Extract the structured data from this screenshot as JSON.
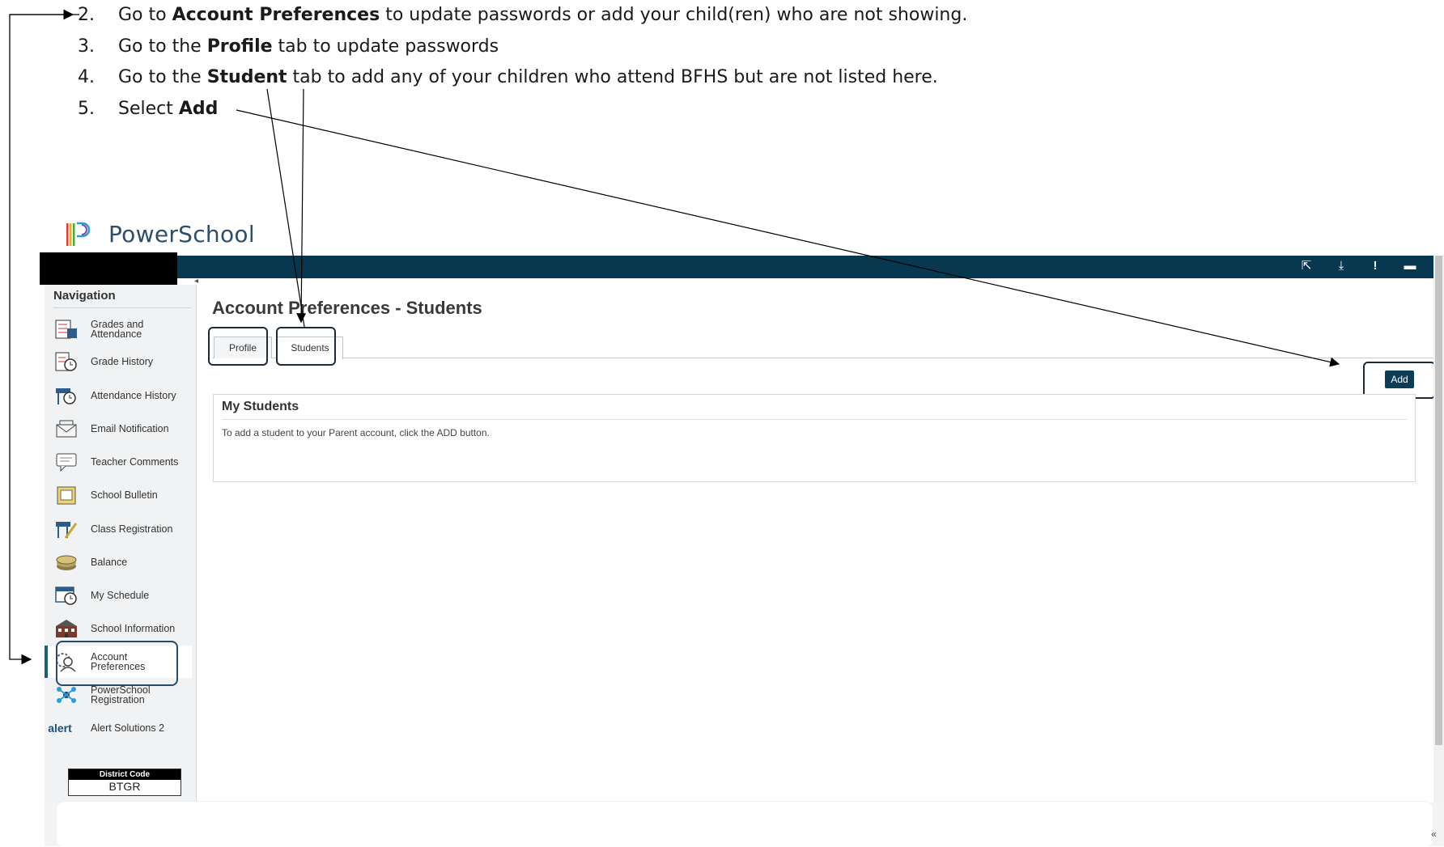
{
  "instructions": {
    "steps": [
      {
        "num": "2.",
        "pre": "Go to ",
        "bold": "Account Preferences",
        "post": " to update passwords or add your child(ren) who are not showing."
      },
      {
        "num": "3.",
        "pre": "Go to the ",
        "bold": "Profile",
        "post": " tab to update passwords"
      },
      {
        "num": "4.",
        "pre": "Go to the ",
        "bold": "Student",
        "post": " tab to add any of your children who attend BFHS but are not listed here."
      },
      {
        "num": "5.",
        "pre": "Select  ",
        "bold": "Add",
        "post": ""
      }
    ]
  },
  "brand": {
    "name": "PowerSchool",
    "logo_colors": [
      "#e03a3e",
      "#f5a623",
      "#3fae49",
      "#2d9cdb",
      "#7b4fa0"
    ]
  },
  "header": {
    "icons": [
      "external-link-icon",
      "download-icon",
      "alert-icon",
      "print-icon"
    ]
  },
  "navigation": {
    "title": "Navigation",
    "items": [
      {
        "label": "Grades and Attendance",
        "icon": "grades-icon"
      },
      {
        "label": "Grade History",
        "icon": "grade-history-icon"
      },
      {
        "label": "Attendance History",
        "icon": "attendance-history-icon"
      },
      {
        "label": "Email Notification",
        "icon": "email-icon"
      },
      {
        "label": "Teacher Comments",
        "icon": "comments-icon"
      },
      {
        "label": "School Bulletin",
        "icon": "bulletin-icon"
      },
      {
        "label": "Class Registration",
        "icon": "class-registration-icon"
      },
      {
        "label": "Balance",
        "icon": "balance-icon"
      },
      {
        "label": "My Schedule",
        "icon": "schedule-icon"
      },
      {
        "label": "School Information",
        "icon": "school-icon"
      },
      {
        "label": "Account Preferences",
        "icon": "account-icon",
        "active": true
      },
      {
        "label": "PowerSchool Registration",
        "icon": "registration-icon"
      },
      {
        "label": "Alert Solutions 2",
        "icon": "alert-logo-icon",
        "icon_text": "alert"
      }
    ],
    "district": {
      "label": "District Code",
      "value": "BTGR"
    }
  },
  "main": {
    "title": "Account Preferences - Students",
    "tabs": [
      {
        "label": "Profile"
      },
      {
        "label": "Students",
        "active": true
      }
    ],
    "add_label": "Add",
    "panel": {
      "title": "My Students",
      "text": "To add a student to your Parent account, click the ADD button."
    }
  },
  "colors": {
    "header": "#08384f",
    "add_button": "#0d3c55",
    "active_nav": "#1c5d7a"
  }
}
